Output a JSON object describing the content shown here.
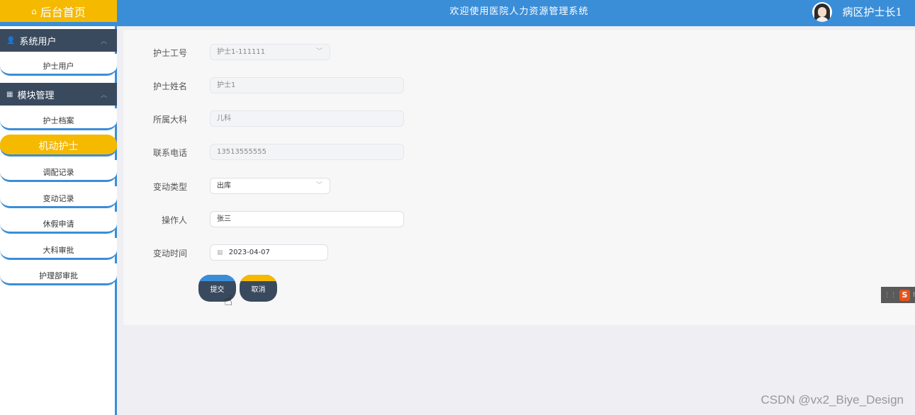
{
  "header": {
    "home_label": "后台首页",
    "system_title": "欢迎使用医院人力资源管理系统",
    "user_name": "病区护士长1"
  },
  "sidebar": {
    "groups": [
      {
        "title": "系统用户",
        "items": [
          "护士用户"
        ]
      },
      {
        "title": "模块管理",
        "items": [
          "护士档案",
          "机动护士",
          "调配记录",
          "变动记录",
          "休假申请",
          "大科审批",
          "护理部审批"
        ]
      }
    ],
    "active_item": "机动护士"
  },
  "form": {
    "nurse_id": {
      "label": "护士工号",
      "value": "护士1-111111"
    },
    "nurse_name": {
      "label": "护士姓名",
      "value": "护士1"
    },
    "department": {
      "label": "所属大科",
      "value": "儿科"
    },
    "phone": {
      "label": "联系电话",
      "value": "13513555555"
    },
    "change_type": {
      "label": "变动类型",
      "value": "出库"
    },
    "operator": {
      "label": "操作人",
      "value": "张三"
    },
    "change_time": {
      "label": "变动时间",
      "value": "2023-04-07"
    },
    "submit_label": "提交",
    "cancel_label": "取消"
  },
  "ime": {
    "glyph": "S"
  },
  "watermark": "CSDN @vx2_Biye_Design",
  "colors": {
    "primary": "#3a8ed8",
    "accent": "#f5b900",
    "dark": "#3a4a5e"
  }
}
